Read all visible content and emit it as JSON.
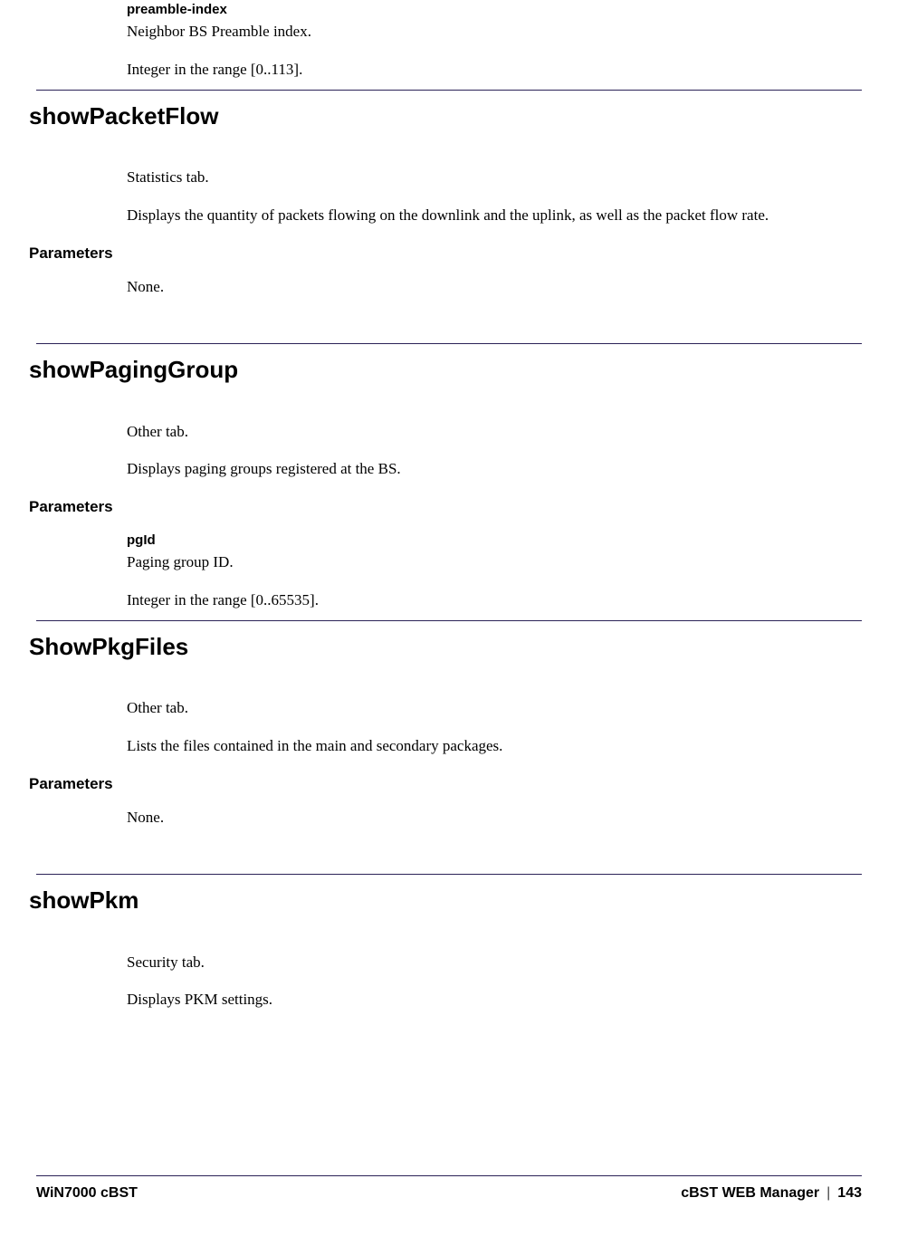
{
  "intro": {
    "param_name": "preamble-index",
    "line1": "Neighbor BS Preamble index.",
    "line2": "Integer in the range [0..113]."
  },
  "sections": [
    {
      "title": "showPacketFlow",
      "line1": "Statistics tab.",
      "line2": "Displays the quantity of packets flowing on the downlink and the uplink, as well as the packet flow rate.",
      "params_label": "Parameters",
      "params_text": "None."
    },
    {
      "title": "showPagingGroup",
      "line1": "Other tab.",
      "line2": "Displays paging groups registered at the BS.",
      "params_label": "Parameters",
      "param_name": "pgId",
      "param_desc": "Paging group ID.",
      "param_range": "Integer in the range [0..65535]."
    },
    {
      "title": "ShowPkgFiles",
      "line1": "Other tab.",
      "line2": "Lists the files contained in the main and secondary packages.",
      "params_label": "Parameters",
      "params_text": "None."
    },
    {
      "title": "showPkm",
      "line1": "Security tab.",
      "line2": "Displays PKM settings."
    }
  ],
  "footer": {
    "left": "WiN7000 cBST",
    "right_label": "cBST WEB Manager",
    "page_num": "143"
  }
}
